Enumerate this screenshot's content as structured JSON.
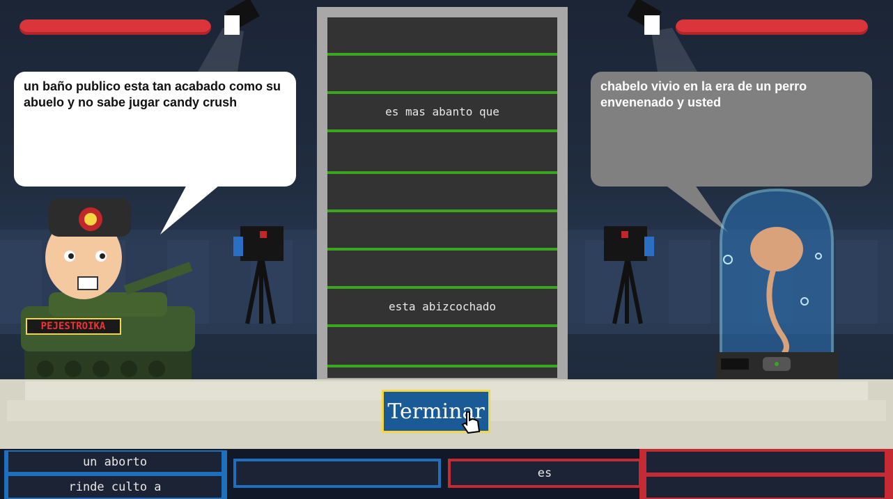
{
  "player_left": {
    "speech": " un baño publico esta tan acabado como su abuelo y no sabe jugar candy crush",
    "tank_label": "PEJESTROIKA"
  },
  "player_right": {
    "speech": " chabelo vivio en la era de un perro envenenado y usted"
  },
  "board": {
    "rows": [
      "",
      "",
      "es mas abanto que",
      "",
      "",
      "",
      "",
      "esta abizcochado",
      ""
    ]
  },
  "finish_button": {
    "label": "Terminar"
  },
  "left_cards": [
    "un aborto",
    "rinde culto a"
  ],
  "middle_left_card": "",
  "middle_right_card": "es",
  "right_cards": [
    "",
    ""
  ],
  "colors": {
    "health": "#d9353b",
    "accent_blue": "#1f6fbf",
    "accent_red": "#c62b34",
    "line_green": "#3aa51f"
  }
}
